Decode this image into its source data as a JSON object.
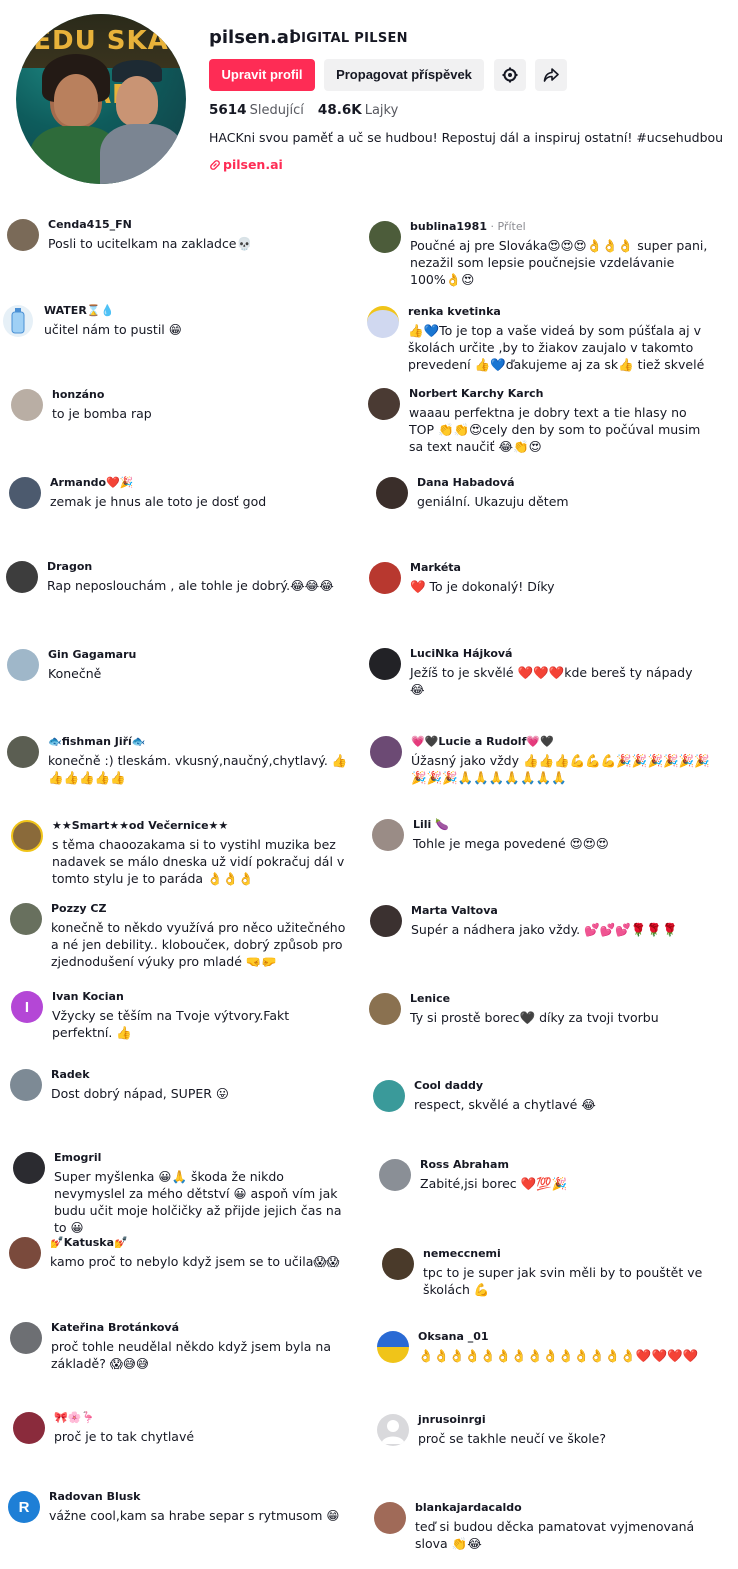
{
  "profile": {
    "username": "pilsen.ai",
    "nickname": "DIGITAL PILSEN",
    "avatar_banner": "EDU SKA RAP",
    "edit_button": "Upravit profil",
    "promote_button": "Propagovat příspěvek",
    "settings_icon": "gear-icon",
    "share_icon": "share-arrow-icon",
    "following_count": "5614",
    "following_label": "Sledující",
    "likes_count": "48.6K",
    "likes_label": "Lajky",
    "bio": "HACKni svou paměť a uč se hudbou! Repostuj dál a inspiruj ostatní! #ucsehudbou",
    "link": "pilsen.ai",
    "accent_color": "#fe2c55"
  },
  "comments_left": [
    {
      "author": "Cenda415_FN",
      "text": "Posli to ucitelkam na zakladce💀"
    },
    {
      "author": "WATER⌛💧",
      "text": "učitel nám to pustil 😁"
    },
    {
      "author": "honzáno",
      "text": "to je bomba rap"
    },
    {
      "author": "Armando❤️🎉",
      "text": "zemak je hnus ale toto je dosť god"
    },
    {
      "author": "Dragon",
      "text": "Rap neposlouchám , ale tohle je dobrý.😂😂😂"
    },
    {
      "author": "Gin Gagamaru",
      "text": "Konečně"
    },
    {
      "author": "🐟fishman Jiří🐟",
      "text": "konečně :) tleskám. vkusný,naučný,chytlavý. 👍👍👍👍👍👍"
    },
    {
      "author": "★★Smart★★od Večernice★★",
      "text": "s těma chaoozakama si to vystihl muzika bez nadavek se málo dneska už vidí pokračuj dál v tomto stylu je to paráda 👌👌👌"
    },
    {
      "author": "Pozzy CZ",
      "text": "konečně to někdo využívá pro něco užitečného a né jen debility.. kloboučeк, dobrý způsob pro zjednodušení výuky pro mladé 🤜🤛"
    },
    {
      "author": "Ivan Kocian",
      "text": "Vžycky se těším na Tvoje výtvory.Fakt perfektní. 👍"
    },
    {
      "author": "Radek",
      "text": "Dost dobrý nápad, SUPER 😛"
    },
    {
      "author": "Emogril",
      "text": "Super myšlenka 😀🙏 škoda že nikdo nevymyslel za mého dětství 😀 aspoň vím jak budu učit moje holčičky až přijde jejich čas na to 😀"
    },
    {
      "author": "💅Katuska💅",
      "text": "kamo proč to nebylo když jsem se to učila😱😱"
    },
    {
      "author": "Kateřina Brotánková",
      "text": "proč tohle neudělal někdo když jsem byla na základě? 😱😅😅"
    },
    {
      "author": "🎀🌸🦩",
      "text": "proč je to tak chytlavé"
    },
    {
      "author": "Radovan Blusk",
      "text": "vážne cool,kam sa hrabe separ s rytmusom 😁"
    }
  ],
  "comments_right": [
    {
      "author": "bublina1981",
      "tag": " · Přítel",
      "text": "Poučné aj pre Slováka😍😍😍👌👌👌 super pani, nezažil som lepsie poučnejsie vzdelávanie 100%👌😍"
    },
    {
      "author": "renka kvetinka",
      "text": "👍💙To je top a vaše videá by som púšťala aj v školách určite ,by to žiakov zaujalo v takomto prevedení 👍💙ďakujeme aj za sk👍 tiež skvelé"
    },
    {
      "author": "Norbert Karchy Karch",
      "text": "waaau perfektna je dobry text a tie hlasy no TOP 👏👏😍cely den by som to počúval musim sa text naučiť 😂👏😍"
    },
    {
      "author": "Dana Habadová",
      "text": "geniální. Ukazuju dětem"
    },
    {
      "author": "Markéta",
      "text": "❤️ To je dokonalý! Díky"
    },
    {
      "author": "LuciNka Hájková",
      "text": "Ježíš to je skvělé ❤️❤️❤️kde bereš ty nápady 😂"
    },
    {
      "author": "💗🖤Lucie a Rudolf💗🖤",
      "text": "Úžasný jako vždy 👍👍👍💪💪💪🎉🎉🎉🎉🎉🎉🎉🎉🎉🙏🙏🙏🙏🙏🙏🙏"
    },
    {
      "author": "Lili 🍆",
      "text": "Tohle je mega povedené 😍😍😍"
    },
    {
      "author": "Marta Valtova",
      "text": "Supér a nádhera jako vždy. 💕💕💕🌹🌹🌹"
    },
    {
      "author": "Lenice",
      "text": "Ty si prostě borec🖤 díky za tvoji tvorbu"
    },
    {
      "author": "Cool daddy",
      "text": "respect, skvělé a chytlavé 😂"
    },
    {
      "author": "Ross Abraham",
      "text": "Zabité,jsi borec ❤️💯🎉"
    },
    {
      "author": "nemeccnemi",
      "text": "tpc to je super jak svin měli by to pouštět ve školách 💪"
    },
    {
      "author": "Oksana _01",
      "text": "👌👌👌👌👌👌👌👌👌👌👌👌👌👌❤️❤️❤️❤️"
    },
    {
      "author": "jnrusoinrgi",
      "text": "proč se takhle neučí ve škole?"
    },
    {
      "author": "blankajardacaldo",
      "text": "teď si budou děcka pamatovat vyjmenovaná slova 👏😂"
    }
  ]
}
